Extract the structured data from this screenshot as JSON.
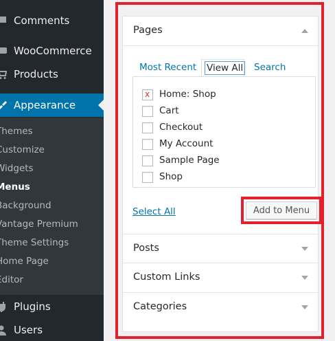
{
  "sidebar": {
    "items": [
      {
        "label": "Comments",
        "icon": "comment-icon"
      },
      {
        "label": "WooCommerce",
        "icon": "woocommerce-icon"
      },
      {
        "label": "Products",
        "icon": "products-icon"
      },
      {
        "label": "Appearance",
        "icon": "paintbrush-icon"
      },
      {
        "label": "Plugins",
        "icon": "plugin-icon"
      },
      {
        "label": "Users",
        "icon": "users-icon"
      }
    ],
    "submenu": [
      {
        "label": "Themes"
      },
      {
        "label": "Customize"
      },
      {
        "label": "Widgets"
      },
      {
        "label": "Menus"
      },
      {
        "label": "Background"
      },
      {
        "label": "Vantage Premium"
      },
      {
        "label": "Theme Settings"
      },
      {
        "label": "Home Page"
      },
      {
        "label": "Editor"
      }
    ],
    "current_submenu": "Menus"
  },
  "pages_section": {
    "title": "Pages",
    "tabs": [
      {
        "label": "Most Recent"
      },
      {
        "label": "View All"
      },
      {
        "label": "Search"
      }
    ],
    "active_tab": "View All",
    "items": [
      {
        "label": "Home: Shop",
        "checked": true
      },
      {
        "label": "Cart",
        "checked": false
      },
      {
        "label": "Checkout",
        "checked": false
      },
      {
        "label": "My Account",
        "checked": false
      },
      {
        "label": "Sample Page",
        "checked": false
      },
      {
        "label": "Shop",
        "checked": false
      }
    ],
    "select_all": "Select All",
    "add_button": "Add to Menu"
  },
  "collapsed_sections": [
    {
      "title": "Posts"
    },
    {
      "title": "Custom Links"
    },
    {
      "title": "Categories"
    }
  ],
  "colors": {
    "sidebar_bg": "#23282d",
    "submenu_bg": "#32373c",
    "accent": "#0073aa",
    "highlight_border": "#e3202c"
  }
}
